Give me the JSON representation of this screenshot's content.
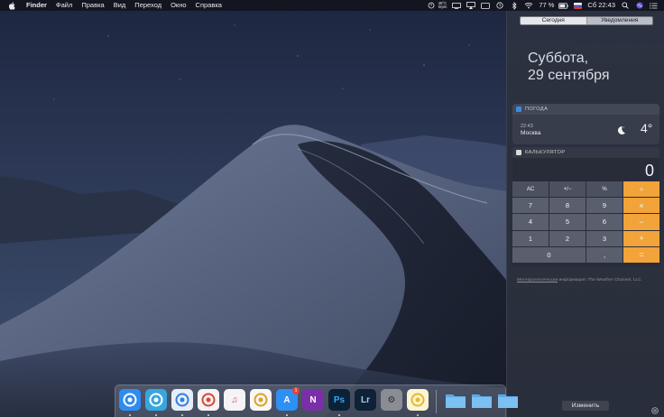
{
  "menubar": {
    "app_name": "Finder",
    "menus": [
      "Файл",
      "Правка",
      "Вид",
      "Переход",
      "Окно",
      "Справка"
    ],
    "temperature": "48°C",
    "temperature_sub": "0rpm",
    "battery": "77 %",
    "clock": "Сб 22:43",
    "icons": [
      "apple-icon",
      "temperature-icon",
      "cast-icon",
      "airplay-icon",
      "display-icon",
      "time-machine-icon",
      "bluetooth-icon",
      "wifi-icon",
      "battery-icon",
      "flag-icon",
      "search-icon",
      "siri-icon",
      "list-icon"
    ]
  },
  "notification_center": {
    "tabs": [
      {
        "label": "Сегодня",
        "active": true
      },
      {
        "label": "Уведомления",
        "active": false
      }
    ],
    "date_line1": "Суббота,",
    "date_line2": "29 сентября",
    "weather": {
      "title": "ПОГОДА",
      "time": "22:43",
      "city": "Москва",
      "temperature": "4°",
      "condition_icon": "moon-icon"
    },
    "calculator": {
      "title": "КАЛЬКУЛЯТОР",
      "display": "0",
      "keys": [
        {
          "label": "AC",
          "kind": "fn"
        },
        {
          "label": "+/−",
          "kind": "fn"
        },
        {
          "label": "%",
          "kind": "fn"
        },
        {
          "label": "÷",
          "kind": "op"
        },
        {
          "label": "7",
          "kind": "num"
        },
        {
          "label": "8",
          "kind": "num"
        },
        {
          "label": "9",
          "kind": "num"
        },
        {
          "label": "×",
          "kind": "op"
        },
        {
          "label": "4",
          "kind": "num"
        },
        {
          "label": "5",
          "kind": "num"
        },
        {
          "label": "6",
          "kind": "num"
        },
        {
          "label": "−",
          "kind": "op"
        },
        {
          "label": "1",
          "kind": "num"
        },
        {
          "label": "2",
          "kind": "num"
        },
        {
          "label": "3",
          "kind": "num"
        },
        {
          "label": "+",
          "kind": "op"
        },
        {
          "label": "0",
          "kind": "zero"
        },
        {
          "label": ",",
          "kind": "num"
        },
        {
          "label": "=",
          "kind": "op"
        }
      ]
    },
    "attribution_link": "Метеорологическая",
    "attribution_text": " информация: The Weather Channel, LLC",
    "edit_label": "Изменить"
  },
  "dock": {
    "apps": [
      {
        "name": "finder-icon",
        "label": "",
        "bg": "#2f8df0",
        "fg": "#ffffff",
        "running": true
      },
      {
        "name": "telegram-icon",
        "label": "",
        "bg": "#37a6e0",
        "fg": "#ffffff",
        "running": true
      },
      {
        "name": "safari-icon",
        "label": "",
        "bg": "#e8eef8",
        "fg": "#2f7fe0",
        "running": true
      },
      {
        "name": "chrome-icon",
        "label": "",
        "bg": "#f4f4f4",
        "fg": "#dc4437",
        "running": true
      },
      {
        "name": "music-icon",
        "label": "♫",
        "bg": "#f4f4f6",
        "fg": "#f0455c",
        "running": false
      },
      {
        "name": "photos-icon",
        "label": "",
        "bg": "#f7f7f7",
        "fg": "#e0a020",
        "running": false
      },
      {
        "name": "app-store-icon",
        "label": "A",
        "bg": "#2e8ff4",
        "fg": "#ffffff",
        "running": true,
        "badge": "1"
      },
      {
        "name": "onenote-icon",
        "label": "N",
        "bg": "#7a2fa8",
        "fg": "#ffffff",
        "running": false
      },
      {
        "name": "photoshop-icon",
        "label": "Ps",
        "bg": "#0b2236",
        "fg": "#31a8ff",
        "running": true
      },
      {
        "name": "lightroom-icon",
        "label": "Lr",
        "bg": "#0d2237",
        "fg": "#a8c8e8",
        "running": false
      },
      {
        "name": "system-preferences-icon",
        "label": "⚙",
        "bg": "#8a8d94",
        "fg": "#2c2e33",
        "running": false
      },
      {
        "name": "notes-icon",
        "label": "",
        "bg": "#fbf4d2",
        "fg": "#e5b92e",
        "running": true
      }
    ],
    "folders": [
      {
        "name": "downloads-folder-icon"
      },
      {
        "name": "folder-icon"
      },
      {
        "name": "folder-icon-2"
      }
    ]
  }
}
